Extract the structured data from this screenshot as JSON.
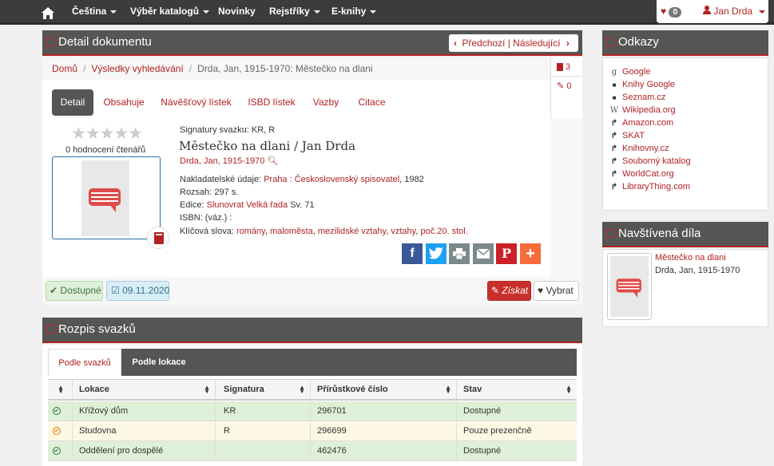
{
  "nav": {
    "menu": [
      "Čeština",
      "Výběr katalogů",
      "Novinky",
      "Rejstříky",
      "E-knihy"
    ],
    "favorites_count": "0",
    "user": "Jan Drda"
  },
  "detail": {
    "title": "Detail dokumentu",
    "pager": "Předchozí | Následující",
    "breadcrumb": [
      "Domů",
      "Výsledky vyhledávání",
      "Drda, Jan, 1915-1970: Městečko na dlani"
    ],
    "side_counts": [
      "3",
      "0"
    ],
    "tabs": [
      "Detail",
      "Obsahuje",
      "Návěšťový lístek",
      "ISBD lístek",
      "Vazby",
      "Citace"
    ],
    "rating_text": "0 hodnocení čtenářů",
    "signatures": "Signatury svazku: KR, R",
    "book_title": "Městečko na dlani / Jan Drda",
    "author": "Drda, Jan, 1915-1970",
    "publisher_label": "Nakladatelské údaje:",
    "publisher_link": "Praha : Československý spisovatel",
    "publisher_year": ", 1982",
    "extent": "Rozsah: 297 s.",
    "series_label": "Edice:",
    "series_link": "Slunovrat Velká řada",
    "series_num": " Sv. 71",
    "isbn": "ISBN: (váz.) :",
    "keywords_label": "Klíčová slova:",
    "keywords": [
      "romány",
      "maloměsta",
      "mezilidské vztahy",
      "vztahy",
      "poč.20. stol."
    ],
    "available": "Dostupné",
    "date": "09.11.2020",
    "get_btn": "Získat",
    "pick_btn": "Vybrat"
  },
  "links": {
    "title": "Odkazy",
    "items": [
      {
        "label": "Google",
        "icon": "google-icon"
      },
      {
        "label": "Knihy Google",
        "icon": "book-icon"
      },
      {
        "label": "Seznam.cz",
        "icon": "book-icon"
      },
      {
        "label": "Wikipedia.org",
        "icon": "wikipedia-icon"
      },
      {
        "label": "Amazon.com",
        "icon": "share-arrow-icon"
      },
      {
        "label": "SKAT",
        "icon": "share-arrow-icon"
      },
      {
        "label": "Knihovny.cz",
        "icon": "share-arrow-icon"
      },
      {
        "label": "Souborný katalog",
        "icon": "share-arrow-icon"
      },
      {
        "label": "WorldCat.org",
        "icon": "share-arrow-icon"
      },
      {
        "label": "LibraryThing.com",
        "icon": "share-arrow-icon"
      }
    ]
  },
  "visited": {
    "title": "Navštívená díla",
    "item_title": "Městečko na dlani",
    "item_author": "Drda, Jan, 1915-1970"
  },
  "volumes": {
    "title": "Rozpis svazků",
    "tabs": [
      "Podle svazků",
      "Podle lokace"
    ],
    "columns": [
      "Lokace",
      "Signatura",
      "Přírůstkové číslo",
      "Stav"
    ],
    "rows": [
      {
        "location": "Křížový dům",
        "signature": "KR",
        "number": "296701",
        "status": "Dostupné",
        "color": "#dff0d8",
        "icon_color": "#3c763d"
      },
      {
        "location": "Studovna",
        "signature": "R",
        "number": "296699",
        "status": "Pouze prezenčně",
        "color": "#fcf8e3",
        "icon_color": "#e67e00"
      },
      {
        "location": "Oddělení pro dospělé",
        "signature": "",
        "number": "462476",
        "status": "Dostupné",
        "color": "#dff0d8",
        "icon_color": "#3c763d"
      }
    ]
  },
  "colors": {
    "accent": "#b22222",
    "header": "#555555",
    "nav": "#3c3c3c"
  }
}
